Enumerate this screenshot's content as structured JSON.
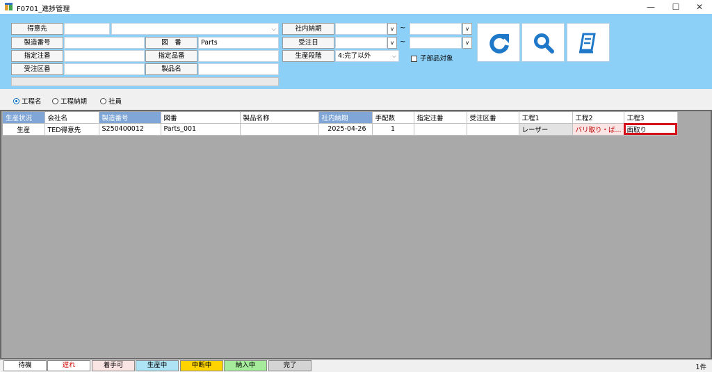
{
  "window": {
    "title": "F0701_進捗管理",
    "controls": {
      "minimize": "—",
      "maximize": "☐",
      "close": "✕"
    }
  },
  "filters": {
    "customer_label": "得意先",
    "customer_code": "",
    "customer_name": "",
    "serial_no_label": "製造番号",
    "serial_no": "",
    "drawing_no_label": "図　番",
    "drawing_no": "Parts",
    "order_no_label": "指定注番",
    "order_no": "",
    "item_no_label": "指定品番",
    "item_no": "",
    "order_div_label": "受注区番",
    "order_div": "",
    "product_name_label": "製品名",
    "product_name": "",
    "internal_due_label": "社内納期",
    "internal_due_from": "",
    "internal_due_to": "",
    "order_date_label": "受注日",
    "order_date_from": "",
    "order_date_to": "",
    "stage_label": "生産段階",
    "stage_value": "4:完了以外",
    "subparts_label": "子部品対象",
    "subparts_checked": false,
    "range_sep": "~",
    "v": "v"
  },
  "toolbar": {
    "refresh_icon": "refresh-icon",
    "search_icon": "search-icon",
    "print_icon": "print-icon",
    "icon_color": "#1f78c8"
  },
  "view_mode": {
    "options": [
      "工程名",
      "工程納期",
      "社員"
    ],
    "selected": "工程名"
  },
  "grid": {
    "columns": [
      "生産状況",
      "会社名",
      "製造番号",
      "図番",
      "製品名称",
      "社内納期",
      "手配数",
      "指定注番",
      "受注区番",
      "工程1",
      "工程2",
      "工程3"
    ],
    "highlighted_columns": [
      "生産状況",
      "製造番号",
      "社内納期"
    ],
    "rows": [
      {
        "status": "生産",
        "company": "TED得意先",
        "serial_no": "S250400012",
        "drawing_no": "Parts_001",
        "product_name": "",
        "internal_due": "2025-04-26",
        "qty": "1",
        "order_no": "",
        "order_div": "",
        "process1": "レーザー",
        "process2": "バリ取り・ば...",
        "process3": "面取り"
      }
    ]
  },
  "legend": [
    {
      "label": "待機",
      "bg": "#ffffff",
      "color": "#000000"
    },
    {
      "label": "遅れ",
      "bg": "#ffffff",
      "color": "#d00000"
    },
    {
      "label": "着手可",
      "bg": "#fbe4e4",
      "color": "#000000"
    },
    {
      "label": "生産中",
      "bg": "#aee3f5",
      "color": "#000000"
    },
    {
      "label": "中断中",
      "bg": "#ffd400",
      "color": "#000000"
    },
    {
      "label": "納入中",
      "bg": "#a6ea9c",
      "color": "#000000"
    },
    {
      "label": "完了",
      "bg": "#d4d4d4",
      "color": "#000000"
    }
  ],
  "record_count": "1件"
}
